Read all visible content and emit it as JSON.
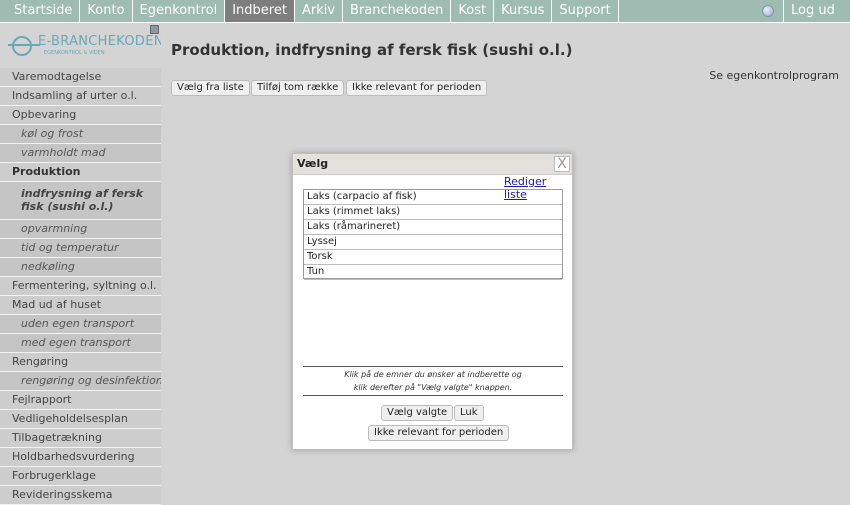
{
  "nav": {
    "items": [
      {
        "label": "Startside"
      },
      {
        "label": "Konto"
      },
      {
        "label": "Egenkontrol"
      },
      {
        "label": "Indberet",
        "active": true
      },
      {
        "label": "Arkiv"
      },
      {
        "label": "Branchekoden"
      },
      {
        "label": "Kost"
      },
      {
        "label": "Kursus"
      },
      {
        "label": "Support"
      }
    ],
    "logout": "Log ud",
    "help_icon": "help-icon"
  },
  "logo": {
    "title": "E-BRANCHEKODEN",
    "subtitle": "EGENKONTROL & VIDEN"
  },
  "header": {
    "title": "Produktion, indfrysning af fersk fisk (sushi o.l.)"
  },
  "sidebar": {
    "items": [
      {
        "label": "Varemodtagelse"
      },
      {
        "label": "Indsamling af urter o.l."
      },
      {
        "label": "Opbevaring"
      },
      {
        "label": "køl og frost",
        "sub": true
      },
      {
        "label": "varmholdt mad",
        "sub": true
      },
      {
        "label": "Produktion",
        "bold": true
      },
      {
        "label": "indfrysning af fersk fisk (sushi o.l.)",
        "sub": true,
        "selected": true
      },
      {
        "label": "opvarmning",
        "sub": true
      },
      {
        "label": "tid og temperatur",
        "sub": true
      },
      {
        "label": "nedkøling",
        "sub": true
      },
      {
        "label": "Fermentering, syltning o.l."
      },
      {
        "label": "Mad ud af huset"
      },
      {
        "label": "uden egen transport",
        "sub": true
      },
      {
        "label": "med egen transport",
        "sub": true
      },
      {
        "label": "Rengøring"
      },
      {
        "label": "rengøring og desinfektion",
        "sub": true
      },
      {
        "label": "Fejlrapport"
      },
      {
        "label": "Vedligeholdelsesplan"
      },
      {
        "label": "Tilbagetrækning"
      },
      {
        "label": "Holdbarhedsvurdering"
      },
      {
        "label": "Forbrugerklage"
      },
      {
        "label": "Revideringsskema"
      }
    ]
  },
  "content": {
    "program_link": "Se egenkontrolprogram",
    "buttons": {
      "choose_from_list": "Vælg fra liste",
      "add_empty_row": "Tilføj tom række",
      "not_relevant": "Ikke relevant for perioden"
    }
  },
  "dialog": {
    "title": "Vælg",
    "close": "X",
    "edit_list": "Rediger liste",
    "list_items": [
      "Laks (carpacio af fisk)",
      "Laks (rimmet laks)",
      "Laks (råmarineret)",
      "Lyssej",
      "Torsk",
      "Tun"
    ],
    "instructions_line1": "Klik på de emner du ønsker at indberette og",
    "instructions_line2": "klik derefter på \"Vælg valgte\" knappen.",
    "buttons": {
      "choose_selected": "Vælg valgte",
      "close": "Luk",
      "not_relevant": "Ikke relevant for perioden"
    }
  },
  "colors": {
    "nav_bg": "#9fbcb3",
    "nav_active": "#7e7e7e",
    "page_bg": "#d4d4d4",
    "logo": "#6aa8b8",
    "link": "#1a1aa6"
  }
}
